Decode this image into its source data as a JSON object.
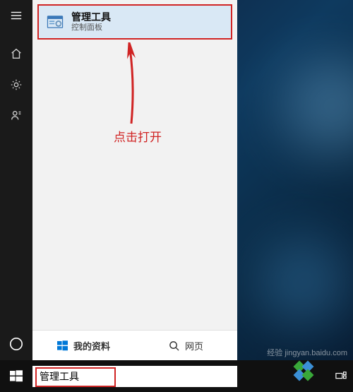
{
  "best_match": {
    "title": "管理工具",
    "subtitle": "控制面板"
  },
  "annotation": "点击打开",
  "tabs": {
    "mine": "我的资料",
    "web": "网页"
  },
  "search": {
    "value": "管理工具"
  },
  "watermark": "经验 jingyan.baidu.com"
}
